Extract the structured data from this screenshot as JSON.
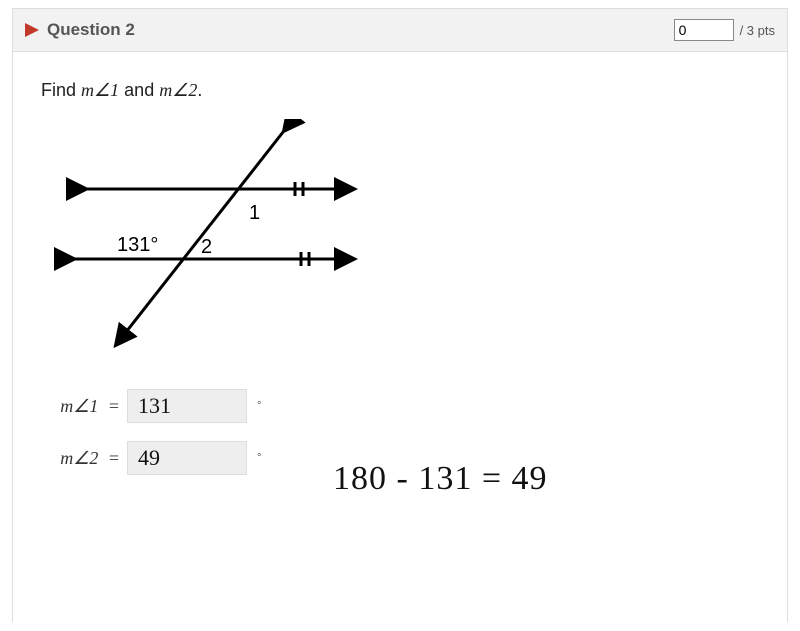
{
  "header": {
    "title": "Question 2",
    "points_value": "0",
    "points_label": "/ 3 pts"
  },
  "prompt": {
    "lead": "Find ",
    "m1": "m∠1",
    "and": " and ",
    "m2": "m∠2",
    "period": "."
  },
  "diagram": {
    "given_angle": "131°",
    "label1": "1",
    "label2": "2"
  },
  "answers": {
    "row1_label": "m∠1",
    "row1_value": "131",
    "row2_label": "m∠2",
    "row2_value": "49",
    "degree_symbol": "°"
  },
  "handwritten": {
    "work": "180 - 131 = 49"
  }
}
